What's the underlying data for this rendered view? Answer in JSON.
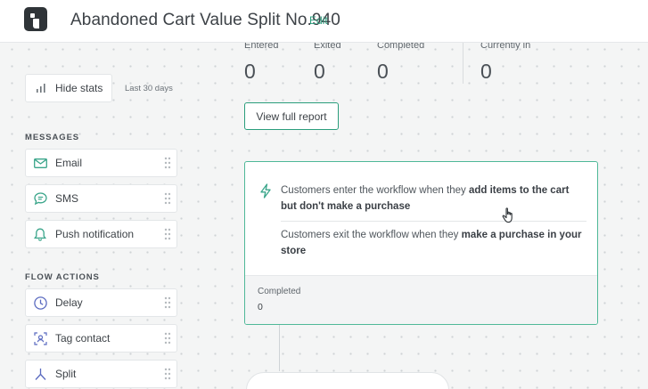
{
  "header": {
    "title": "Abandoned Cart Value Split No.940",
    "edit_label": "Edit"
  },
  "sidebar": {
    "hide_stats_label": "Hide stats",
    "period": "Last 30 days",
    "messages_heading": "MESSAGES",
    "messages": [
      {
        "label": "Email",
        "icon": "mail-icon"
      },
      {
        "label": "SMS",
        "icon": "chat-icon"
      },
      {
        "label": "Push notification",
        "icon": "bell-icon"
      }
    ],
    "flow_heading": "FLOW ACTIONS",
    "flow_actions": [
      {
        "label": "Delay",
        "icon": "clock-icon"
      },
      {
        "label": "Tag contact",
        "icon": "tag-contact-icon"
      },
      {
        "label": "Split",
        "icon": "split-icon"
      }
    ]
  },
  "stats": [
    {
      "label": "Entered",
      "value": "0"
    },
    {
      "label": "Exited",
      "value": "0"
    },
    {
      "label": "Completed",
      "value": "0"
    },
    {
      "label": "Currently in",
      "value": "0"
    }
  ],
  "report_button_label": "View full report",
  "trigger": {
    "enter_prefix": "Customers enter the workflow when they ",
    "enter_bold": "add items to the cart but don't make a purchase",
    "exit_prefix": "Customers exit the workflow when they ",
    "exit_bold": "make a purchase in your store",
    "footer_label": "Completed",
    "footer_value": "0"
  },
  "colors": {
    "accent": "#2a9d7c",
    "card_border": "#4fb898",
    "icon_accent": "#3aa58a"
  }
}
